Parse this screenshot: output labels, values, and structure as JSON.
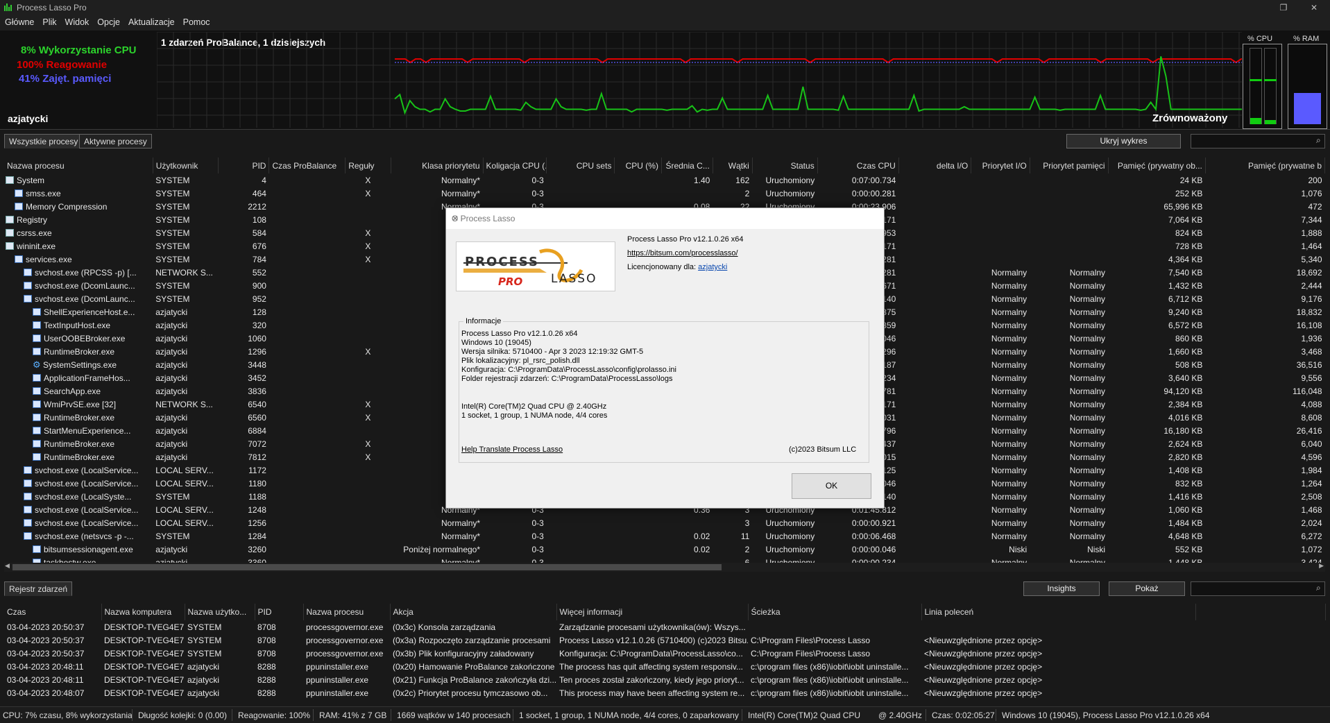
{
  "window": {
    "title": "Process Lasso Pro"
  },
  "menu": [
    "Główne",
    "Plik",
    "Widok",
    "Opcje",
    "Aktualizacje",
    "Pomoc"
  ],
  "stats": {
    "cpu": "8% Wykorzystanie CPU",
    "responsiveness": "100% Reagowanie",
    "memory": "41% Zajęt. pamięci",
    "events": "1 zdarzeń ProBalance, 1 dzisiejszych",
    "user": "azjatycki",
    "balance": "Zrównoważony",
    "cpu_label": "% CPU",
    "ram_label": "% RAM",
    "cpu_meter": 0.08,
    "ram_meter": 0.41,
    "colors": {
      "cpu": "#18c218",
      "resp": "#e00000",
      "mem": "#5a5aff"
    }
  },
  "graph": {
    "cpu_series": [
      26,
      31,
      10,
      24,
      17,
      14,
      14,
      11,
      14,
      14,
      26,
      17,
      14,
      12,
      12,
      14,
      14,
      14,
      14,
      29,
      14,
      14,
      14,
      14,
      14,
      13,
      22,
      17,
      14,
      14,
      14,
      14,
      26,
      17,
      14,
      14,
      14,
      14,
      13,
      14,
      14,
      32,
      14,
      14,
      14,
      14,
      14,
      11,
      14,
      14,
      14,
      14,
      14,
      14,
      13,
      14,
      14,
      14,
      14,
      18,
      11,
      14,
      13,
      14,
      14,
      27,
      14,
      14,
      14,
      14,
      14,
      14,
      14,
      14,
      30,
      14,
      14,
      14,
      14,
      14,
      14,
      40,
      14,
      14,
      14,
      14,
      14,
      14,
      13,
      29,
      14,
      14,
      14,
      14,
      14,
      14,
      14,
      14,
      14,
      14,
      14,
      14,
      14,
      30,
      12,
      14,
      14,
      14,
      14,
      14,
      14,
      14,
      14,
      17,
      14,
      14,
      14,
      14,
      14,
      14,
      14,
      14,
      14,
      14,
      14,
      14,
      14,
      28,
      14,
      14,
      14,
      14,
      13,
      14,
      14,
      14,
      14,
      14,
      14,
      14,
      30,
      14,
      14,
      14,
      14,
      14,
      14,
      14,
      13,
      14,
      22,
      14,
      75,
      52,
      14,
      14,
      14,
      14,
      14,
      14,
      14,
      14,
      14,
      14,
      14,
      14,
      14,
      14,
      14,
      14,
      14
    ],
    "resp_series": [
      100,
      100,
      100,
      96,
      100,
      100,
      96,
      100,
      100,
      100,
      100,
      100,
      100,
      100,
      96,
      100,
      100,
      100,
      100,
      100,
      100,
      100,
      100,
      100,
      100,
      96,
      100,
      100,
      100,
      100,
      100,
      100,
      100,
      100,
      100,
      100,
      100,
      100,
      100,
      100,
      96,
      100,
      100,
      100,
      100,
      100,
      100,
      100,
      100,
      100,
      100,
      100,
      100,
      100,
      100,
      100,
      96,
      100,
      100,
      100,
      100,
      100,
      100,
      100,
      100,
      100,
      96,
      100,
      100,
      100,
      100,
      100,
      100,
      100,
      100,
      100,
      100,
      100,
      100,
      100,
      96,
      100,
      100,
      100,
      100,
      100,
      100,
      100,
      100,
      100,
      100,
      100,
      100,
      100,
      100,
      96,
      100,
      100,
      100,
      100,
      100,
      100,
      100,
      100,
      100,
      100,
      100,
      100,
      100,
      100,
      100,
      100,
      100,
      100,
      100,
      100,
      96,
      100,
      100,
      100,
      100,
      100,
      100,
      100,
      100,
      96,
      100,
      100,
      100,
      100,
      100,
      100,
      100,
      100,
      100,
      100,
      96,
      100,
      100,
      100,
      100,
      100,
      100,
      100,
      100,
      100,
      96,
      100,
      100,
      100,
      100,
      100,
      100,
      100,
      100,
      100,
      100,
      100,
      100,
      100,
      100,
      100,
      96,
      100,
      100,
      100
    ],
    "mem_series_value": 41
  },
  "tabs_top": {
    "all": "Wszystkie procesy",
    "active": "Aktywne procesy",
    "hide_graph": "Ukryj wykres"
  },
  "proc_columns": [
    "Nazwa procesu",
    "Użytkownik",
    "PID",
    "Czas ProBalance",
    "Reguły",
    "Klasa priorytetu",
    "Koligacja CPU (...",
    "CPU sets",
    "CPU (%)",
    "Średnia C...",
    "Wątki",
    "Status",
    "Czas CPU",
    "delta I/O",
    "Priorytet I/O",
    "Priorytet pamięci",
    "Pamięć (prywatny ob...",
    "Pamięć (prywatne b"
  ],
  "processes": [
    [
      "System",
      "SYSTEM",
      "4",
      "",
      "X",
      "Normalny*",
      "0-3",
      "",
      "",
      "1.40",
      "162",
      "Uruchomiony",
      "0:07:00.734",
      "",
      "",
      "",
      "24 KB",
      "200"
    ],
    [
      "smss.exe",
      "SYSTEM",
      "464",
      "",
      "X",
      "Normalny*",
      "0-3",
      "",
      "",
      "",
      "2",
      "Uruchomiony",
      "0:00:00.281",
      "",
      "",
      "",
      "252 KB",
      "1,076"
    ],
    [
      "Memory Compression",
      "SYSTEM",
      "2212",
      "",
      "",
      "Normalny*",
      "0-3",
      "",
      "",
      "0.08",
      "22",
      "Uruchomiony",
      "0:00:23.906",
      "",
      "",
      "",
      "65,996 KB",
      "472"
    ],
    [
      "Registry",
      "SYSTEM",
      "108",
      "",
      "",
      "",
      "",
      "",
      "",
      "",
      "",
      "",
      "0:00:01.171",
      "",
      "",
      "",
      "7,064 KB",
      "7,344"
    ],
    [
      "csrss.exe",
      "SYSTEM",
      "584",
      "",
      "X",
      "",
      "",
      "",
      "",
      "",
      "",
      "",
      "0:00:03.953",
      "",
      "",
      "",
      "824 KB",
      "1,888"
    ],
    [
      "wininit.exe",
      "SYSTEM",
      "676",
      "",
      "X",
      "",
      "",
      "",
      "",
      "",
      "",
      "",
      "0:00:00.171",
      "",
      "",
      "",
      "728 KB",
      "1,464"
    ],
    [
      "services.exe",
      "SYSTEM",
      "784",
      "",
      "X",
      "",
      "",
      "",
      "",
      "",
      "",
      "",
      "0:00:13.281",
      "",
      "",
      "",
      "4,364 KB",
      "5,340"
    ],
    [
      "svchost.exe (RPCSS -p) [...",
      "NETWORK S...",
      "552",
      "",
      "",
      "",
      "",
      "",
      "",
      "",
      "",
      "",
      "0:02:37.281",
      "",
      "Normalny",
      "Normalny",
      "7,540 KB",
      "18,692"
    ],
    [
      "svchost.exe (DcomLaunc...",
      "SYSTEM",
      "900",
      "",
      "",
      "",
      "",
      "",
      "",
      "",
      "",
      "",
      "0:00:00.671",
      "",
      "Normalny",
      "Normalny",
      "1,432 KB",
      "2,444"
    ],
    [
      "svchost.exe (DcomLaunc...",
      "SYSTEM",
      "952",
      "",
      "",
      "",
      "",
      "",
      "",
      "",
      "",
      "",
      "0:00:47.140",
      "",
      "Normalny",
      "Normalny",
      "6,712 KB",
      "9,176"
    ],
    [
      "ShellExperienceHost.e...",
      "azjatycki",
      "128",
      "",
      "",
      "",
      "",
      "",
      "",
      "",
      "",
      "",
      "0:00:00.875",
      "",
      "Normalny",
      "Normalny",
      "9,240 KB",
      "18,832"
    ],
    [
      "TextInputHost.exe",
      "azjatycki",
      "320",
      "",
      "",
      "",
      "",
      "",
      "",
      "",
      "",
      "",
      "0:00:01.859",
      "",
      "Normalny",
      "Normalny",
      "6,572 KB",
      "16,108"
    ],
    [
      "UserOOBEBroker.exe",
      "azjatycki",
      "1060",
      "",
      "",
      "",
      "",
      "",
      "",
      "",
      "",
      "",
      "0:00:00.046",
      "",
      "Normalny",
      "Normalny",
      "860 KB",
      "1,936"
    ],
    [
      "RuntimeBroker.exe",
      "azjatycki",
      "1296",
      "",
      "X",
      "",
      "",
      "",
      "",
      "",
      "",
      "",
      "0:00:00.296",
      "",
      "Normalny",
      "Normalny",
      "1,660 KB",
      "3,468"
    ],
    [
      "SystemSettings.exe",
      "azjatycki",
      "3448",
      "",
      "",
      "",
      "",
      "",
      "",
      "",
      "",
      "",
      "0:00:01.187",
      "",
      "Normalny",
      "Normalny",
      "508 KB",
      "36,516"
    ],
    [
      "ApplicationFrameHos...",
      "azjatycki",
      "3452",
      "",
      "",
      "",
      "",
      "",
      "",
      "",
      "",
      "",
      "0:00:00.234",
      "",
      "Normalny",
      "Normalny",
      "3,640 KB",
      "9,556"
    ],
    [
      "SearchApp.exe",
      "azjatycki",
      "3836",
      "",
      "",
      "",
      "",
      "",
      "",
      "",
      "",
      "",
      "0:00:30.781",
      "",
      "Normalny",
      "Normalny",
      "94,120 KB",
      "116,048"
    ],
    [
      "WmiPrvSE.exe [32]",
      "NETWORK S...",
      "6540",
      "",
      "X",
      "",
      "",
      "",
      "",
      "",
      "",
      "",
      "0:00:00.171",
      "",
      "Normalny",
      "Normalny",
      "2,384 KB",
      "4,088"
    ],
    [
      "RuntimeBroker.exe",
      "azjatycki",
      "6560",
      "",
      "X",
      "",
      "",
      "",
      "",
      "",
      "",
      "",
      "0:00:15.031",
      "",
      "Normalny",
      "Normalny",
      "4,016 KB",
      "8,608"
    ],
    [
      "StartMenuExperience...",
      "azjatycki",
      "6884",
      "",
      "",
      "",
      "",
      "",
      "",
      "",
      "",
      "",
      "0:00:02.796",
      "",
      "Normalny",
      "Normalny",
      "16,180 KB",
      "26,416"
    ],
    [
      "RuntimeBroker.exe",
      "azjatycki",
      "7072",
      "",
      "X",
      "",
      "",
      "",
      "",
      "",
      "",
      "",
      "0:00:02.437",
      "",
      "Normalny",
      "Normalny",
      "2,624 KB",
      "6,040"
    ],
    [
      "RuntimeBroker.exe",
      "azjatycki",
      "7812",
      "",
      "X",
      "",
      "",
      "",
      "",
      "",
      "",
      "",
      "0:00:18.015",
      "",
      "Normalny",
      "Normalny",
      "2,820 KB",
      "4,596"
    ],
    [
      "svchost.exe (LocalService...",
      "LOCAL SERV...",
      "1172",
      "",
      "",
      "",
      "",
      "",
      "",
      "",
      "",
      "",
      "0:00:00.125",
      "",
      "Normalny",
      "Normalny",
      "1,408 KB",
      "1,984"
    ],
    [
      "svchost.exe (LocalService...",
      "LOCAL SERV...",
      "1180",
      "",
      "",
      "",
      "",
      "",
      "",
      "",
      "",
      "",
      "0:00:00.046",
      "",
      "Normalny",
      "Normalny",
      "832 KB",
      "1,264"
    ],
    [
      "svchost.exe (LocalSyste...",
      "SYSTEM",
      "1188",
      "",
      "",
      "",
      "",
      "",
      "",
      "",
      "",
      "",
      "0:00:02.140",
      "",
      "Normalny",
      "Normalny",
      "1,416 KB",
      "2,508"
    ],
    [
      "svchost.exe (LocalService...",
      "LOCAL SERV...",
      "1248",
      "",
      "",
      "Normalny*",
      "0-3",
      "",
      "",
      "0.36",
      "3",
      "Uruchomiony",
      "0:01:45.812",
      "",
      "Normalny",
      "Normalny",
      "1,060 KB",
      "1,468"
    ],
    [
      "svchost.exe (LocalService...",
      "LOCAL SERV...",
      "1256",
      "",
      "",
      "Normalny*",
      "0-3",
      "",
      "",
      "",
      "3",
      "Uruchomiony",
      "0:00:00.921",
      "",
      "Normalny",
      "Normalny",
      "1,484 KB",
      "2,024"
    ],
    [
      "svchost.exe (netsvcs -p -...",
      "SYSTEM",
      "1284",
      "",
      "",
      "Normalny*",
      "0-3",
      "",
      "",
      "0.02",
      "11",
      "Uruchomiony",
      "0:00:06.468",
      "",
      "Normalny",
      "Normalny",
      "4,648 KB",
      "6,272"
    ],
    [
      "bitsumsessionagent.exe",
      "azjatycki",
      "3260",
      "",
      "",
      "Poniżej normalnego*",
      "0-3",
      "",
      "",
      "0.02",
      "2",
      "Uruchomiony",
      "0:00:00.046",
      "",
      "Niski",
      "Niski",
      "552 KB",
      "1,072"
    ],
    [
      "taskhostw.exe",
      "azjatycki",
      "3360",
      "",
      "",
      "Normalny*",
      "0-3",
      "",
      "",
      "",
      "6",
      "Uruchomiony",
      "0:00:00.234",
      "",
      "Normalny",
      "Normalny",
      "1,448 KB",
      "3,424"
    ]
  ],
  "tabs_bottom": {
    "log": "Rejestr zdarzeń",
    "insights": "Insights",
    "show": "Pokaż"
  },
  "log_columns": [
    "Czas",
    "Nazwa komputera",
    "Nazwa użytko...",
    "PID",
    "Nazwa procesu",
    "Akcja",
    "Więcej informacji",
    "Ścieżka",
    "Linia poleceń"
  ],
  "log_rows": [
    [
      "03-04-2023 20:50:37",
      "DESKTOP-TVEG4E7",
      "SYSTEM",
      "8708",
      "processgovernor.exe",
      "(0x3c) Konsola zarządzania",
      "Zarządzanie procesami użytkownika(ów): Wszys...",
      "",
      ""
    ],
    [
      "03-04-2023 20:50:37",
      "DESKTOP-TVEG4E7",
      "SYSTEM",
      "8708",
      "processgovernor.exe",
      "(0x3a) Rozpoczęto zarządzanie procesami",
      "Process Lasso v12.1.0.26 (5710400) (c)2023 Bitsu...",
      "C:\\Program Files\\Process Lasso",
      "<Nieuwzględnione przez opcję>"
    ],
    [
      "03-04-2023 20:50:37",
      "DESKTOP-TVEG4E7",
      "SYSTEM",
      "8708",
      "processgovernor.exe",
      "(0x3b) Plik konfiguracyjny załadowany",
      "Konfiguracja: C:\\ProgramData\\ProcessLasso\\co...",
      "C:\\Program Files\\Process Lasso",
      "<Nieuwzględnione przez opcję>"
    ],
    [
      "03-04-2023 20:48:11",
      "DESKTOP-TVEG4E7",
      "azjatycki",
      "8288",
      "ppuninstaller.exe",
      "(0x20) Hamowanie ProBalance zakończone",
      "The process has quit affecting system responsiv...",
      "c:\\program files (x86)\\iobit\\iobit uninstalle...",
      "<Nieuwzględnione przez opcję>"
    ],
    [
      "03-04-2023 20:48:11",
      "DESKTOP-TVEG4E7",
      "azjatycki",
      "8288",
      "ppuninstaller.exe",
      "(0x21) Funkcja ProBalance zakończyła dzi...",
      "Ten proces został zakończony, kiedy jego prioryt...",
      "c:\\program files (x86)\\iobit\\iobit uninstalle...",
      "<Nieuwzględnione przez opcję>"
    ],
    [
      "03-04-2023 20:48:07",
      "DESKTOP-TVEG4E7",
      "azjatycki",
      "8288",
      "ppuninstaller.exe",
      "(0x2c) Priorytet procesu tymczasowo ob...",
      "This process may have been affecting system re...",
      "c:\\program files (x86)\\iobit\\iobit uninstalle...",
      "<Nieuwzględnione przez opcję>"
    ]
  ],
  "statusbar": {
    "cpu": "CPU: 7% czasu, 8% wykorzystania",
    "queue": "Długość kolejki: 0 (0.00)",
    "resp": "Reagowanie: 100%",
    "ram": "RAM: 41% z 7 GB",
    "threads": "1669 wątków w 140 procesach",
    "topology": "1 socket, 1 group, 1 NUMA node, 4/4 cores, 0 zaparkowany",
    "cpu_model": "Intel(R) Core(TM)2 Quad CPU",
    "freq": "@ 2.40GHz",
    "uptime": "Czas: 0:02:05:27",
    "version": "Windows 10 (19045), Process Lasso Pro v12.1.0.26 x64"
  },
  "dialog": {
    "title": "O Process Lasso",
    "product": "Process Lasso Pro v12.1.0.26 x64",
    "url": "https://bitsum.com/processlasso/",
    "licensed_label": "Licencjonowany dla:",
    "licensed_user": "azjatycki",
    "logo_top": "PROCESS",
    "logo_bottom": "LASSO",
    "logo_pro": "PRO",
    "info_legend": "Informacje",
    "info_lines": [
      "Process Lasso Pro v12.1.0.26 x64",
      "Windows 10 (19045)",
      "Wersja silnika: 5710400 - Apr  3 2023 12:19:32 GMT-5",
      "Plik lokalizacyjny: pl_rsrc_polish.dll",
      "Konfiguracja: C:\\ProgramData\\ProcessLasso\\config\\prolasso.ini",
      "Folder rejestracji zdarzeń: C:\\ProgramData\\ProcessLasso\\logs"
    ],
    "cpu_line": "Intel(R) Core(TM)2 Quad CPU          @ 2.40GHz",
    "topology_line": "1 socket, 1 group, 1 NUMA node, 4/4 cores",
    "help_link": "Help Translate Process Lasso",
    "copyright": "(c)2023 Bitsum LLC",
    "ok": "OK"
  }
}
